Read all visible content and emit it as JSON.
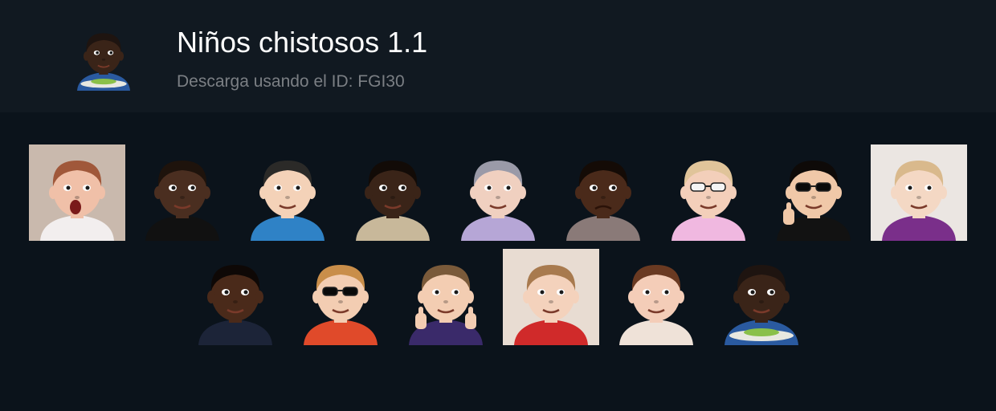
{
  "pack": {
    "title": "Niños chistosos 1.1",
    "subtitle": "Descarga usando el ID: FGI30",
    "cover_icon": "boy-eating-salad-sticker"
  },
  "stickers": {
    "row1": [
      {
        "name": "sticker-redhead-girl-shocked",
        "icon": "redhead-girl-sticker",
        "skin": "#f0c0a8",
        "hair": "#a0583a",
        "shirt": "#f2eeee",
        "bg": "#c9b9ad"
      },
      {
        "name": "sticker-baby-side-eye",
        "icon": "side-eye-baby-sticker",
        "skin": "#4a2e20",
        "hair": "#1e130c",
        "shirt": "#111111",
        "bg": ""
      },
      {
        "name": "sticker-asian-toddler-smirk",
        "icon": "smirking-toddler-sticker",
        "skin": "#f4d2b8",
        "hair": "#2b2a28",
        "shirt": "#2f82c6",
        "bg": ""
      },
      {
        "name": "sticker-boy-serious-look",
        "icon": "serious-boy-sticker",
        "skin": "#3a2418",
        "hair": "#120b07",
        "shirt": "#c8b89a",
        "bg": ""
      },
      {
        "name": "sticker-baby-purple-shirt",
        "icon": "baby-purple-shirt-sticker",
        "skin": "#f0d0c0",
        "hair": "#9a9aa8",
        "shirt": "#b6a6d6",
        "bg": ""
      },
      {
        "name": "sticker-angry-boy-frown",
        "icon": "frowning-boy-sticker",
        "skin": "#4a2a1a",
        "hair": "#140b06",
        "shirt": "#8a7a78",
        "bg": ""
      },
      {
        "name": "sticker-girl-white-sunglasses",
        "icon": "girl-sunglasses-sticker",
        "skin": "#f3cfba",
        "hair": "#e0c49a",
        "shirt": "#f0b8e0",
        "bg": ""
      },
      {
        "name": "sticker-boy-black-sunglasses-thumb",
        "icon": "boy-sunglasses-thumbs-up-sticker",
        "skin": "#f0c8a8",
        "hair": "#0e0a08",
        "shirt": "#121212",
        "bg": ""
      },
      {
        "name": "sticker-blonde-girl-stare",
        "icon": "blonde-girl-sticker",
        "skin": "#f4d8c4",
        "hair": "#d9b98c",
        "shirt": "#7a2f8a",
        "bg": "#ebe6e2"
      }
    ],
    "row2": [
      {
        "name": "sticker-boy-blank-stare",
        "icon": "blank-stare-boy-sticker",
        "skin": "#4a2a1a",
        "hair": "#0e0806",
        "shirt": "#1c2438",
        "bg": ""
      },
      {
        "name": "sticker-redhead-boy-sunglasses-thumb",
        "icon": "redhead-boy-sunglasses-sticker",
        "skin": "#f3cdb2",
        "hair": "#c98e4a",
        "shirt": "#e04a2a",
        "bg": ""
      },
      {
        "name": "sticker-boy-double-thumbs-up",
        "icon": "double-thumbs-up-boy-sticker",
        "skin": "#f3cdb2",
        "hair": "#7a5a3a",
        "shirt": "#3a2a6a",
        "bg": ""
      },
      {
        "name": "sticker-girl-side-smirk",
        "icon": "side-smirk-girl-sticker",
        "skin": "#f4d2bc",
        "hair": "#a87a4e",
        "shirt": "#d02a2a",
        "bg": "#e8dcd2"
      },
      {
        "name": "sticker-boy-wide-eyes",
        "icon": "wide-eyed-boy-sticker",
        "skin": "#f4cdb8",
        "hair": "#6a3a22",
        "shirt": "#efe2d8",
        "bg": ""
      },
      {
        "name": "sticker-boy-eating-salad",
        "icon": "boy-eating-salad-sticker",
        "skin": "#3a2418",
        "hair": "#1e1410",
        "shirt": "#2a5aa0",
        "bg": ""
      }
    ]
  }
}
